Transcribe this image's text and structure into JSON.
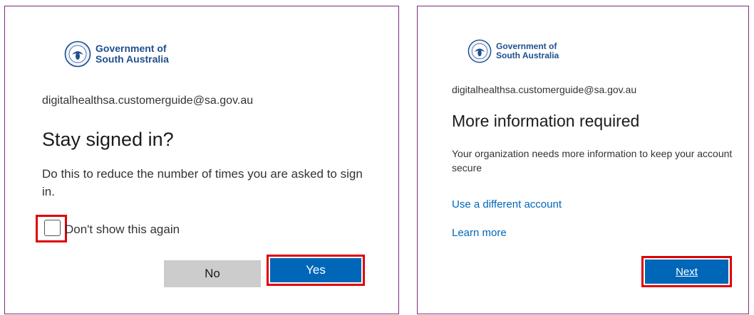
{
  "left_panel": {
    "logo": {
      "line1": "Government of",
      "line2": "South Australia"
    },
    "email": "digitalhealthsa.customerguide@sa.gov.au",
    "title": "Stay signed in?",
    "description": "Do this to reduce the number of times you are asked to sign in.",
    "checkbox_label": "Don't show this again",
    "checkbox_checked": false,
    "no_label": "No",
    "yes_label": "Yes"
  },
  "right_panel": {
    "logo": {
      "line1": "Government of",
      "line2": "South Australia"
    },
    "email": "digitalhealthsa.customerguide@sa.gov.au",
    "title": "More information required",
    "description": "Your organization needs more information to keep your account secure",
    "link_different_account": "Use a different account",
    "link_learn_more": "Learn more",
    "next_label": "Next"
  },
  "colors": {
    "primary_button": "#0067b8",
    "secondary_button": "#cccccc",
    "link": "#0067b8",
    "highlight": "#e00000",
    "panel_border": "#7b2d7e"
  }
}
